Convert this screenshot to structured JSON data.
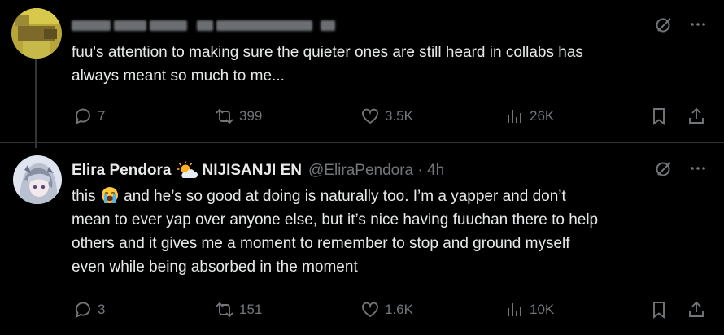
{
  "tweets": [
    {
      "author_name": "",
      "author_org": "",
      "handle": "",
      "time": "",
      "text_lines": [
        "fuu's attention to making sure the quieter ones are still heard in collabs has",
        "always meant so much to me..."
      ],
      "replies": "7",
      "reposts": "399",
      "likes": "3.5K",
      "views": "26K"
    },
    {
      "author_name": "Elira Pendora",
      "author_org": "NIJISANJI EN",
      "handle": "@EliraPendora · 4h",
      "text_lines": [
        "this",
        "and he’s so good at doing is naturally too. I’m a yapper and don’t",
        "mean to ever yap over anyone else, but it’s nice having fuuchan there to help",
        "others and it gives me a moment to remember to stop and ground myself",
        "even while being absorbed in the moment"
      ],
      "replies": "3",
      "reposts": "151",
      "likes": "1.6K",
      "views": "10K"
    }
  ],
  "icons": {
    "grok": "grok-icon",
    "more": "more-icon",
    "reply": "reply-icon",
    "repost": "repost-icon",
    "like": "heart-icon",
    "views": "views-icon",
    "bookmark": "bookmark-icon",
    "share": "share-icon",
    "sun": "sun-behind-cloud-icon",
    "crying": "loudly-crying-face-icon"
  },
  "colors": {
    "background": "#000000",
    "text": "#e7e9ea",
    "muted": "#71767b",
    "divider": "#2f3336"
  }
}
